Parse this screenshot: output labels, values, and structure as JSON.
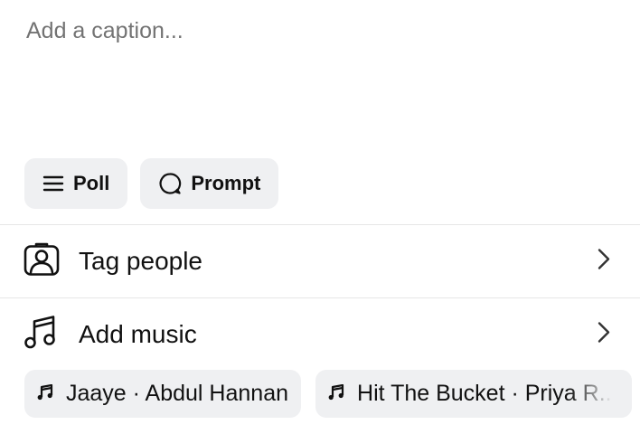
{
  "caption": {
    "placeholder": "Add a caption..."
  },
  "chips": {
    "poll_label": "Poll",
    "prompt_label": "Prompt"
  },
  "rows": {
    "tag_people_label": "Tag people",
    "add_music_label": "Add music"
  },
  "music_suggestions": [
    {
      "text": "Jaaye · Abdul Hannan"
    },
    {
      "text": "Hit The Bucket · Priya R..."
    }
  ],
  "icons": {
    "poll": "list-icon",
    "prompt": "speech-bubble-icon",
    "tag_people": "person-tag-icon",
    "add_music": "music-note-icon",
    "chevron": "chevron-right-icon",
    "music_chip": "music-note-icon"
  },
  "colors": {
    "chip_bg": "#eff0f2",
    "divider": "#e6e6e6",
    "placeholder": "#737373",
    "text": "#111111"
  }
}
